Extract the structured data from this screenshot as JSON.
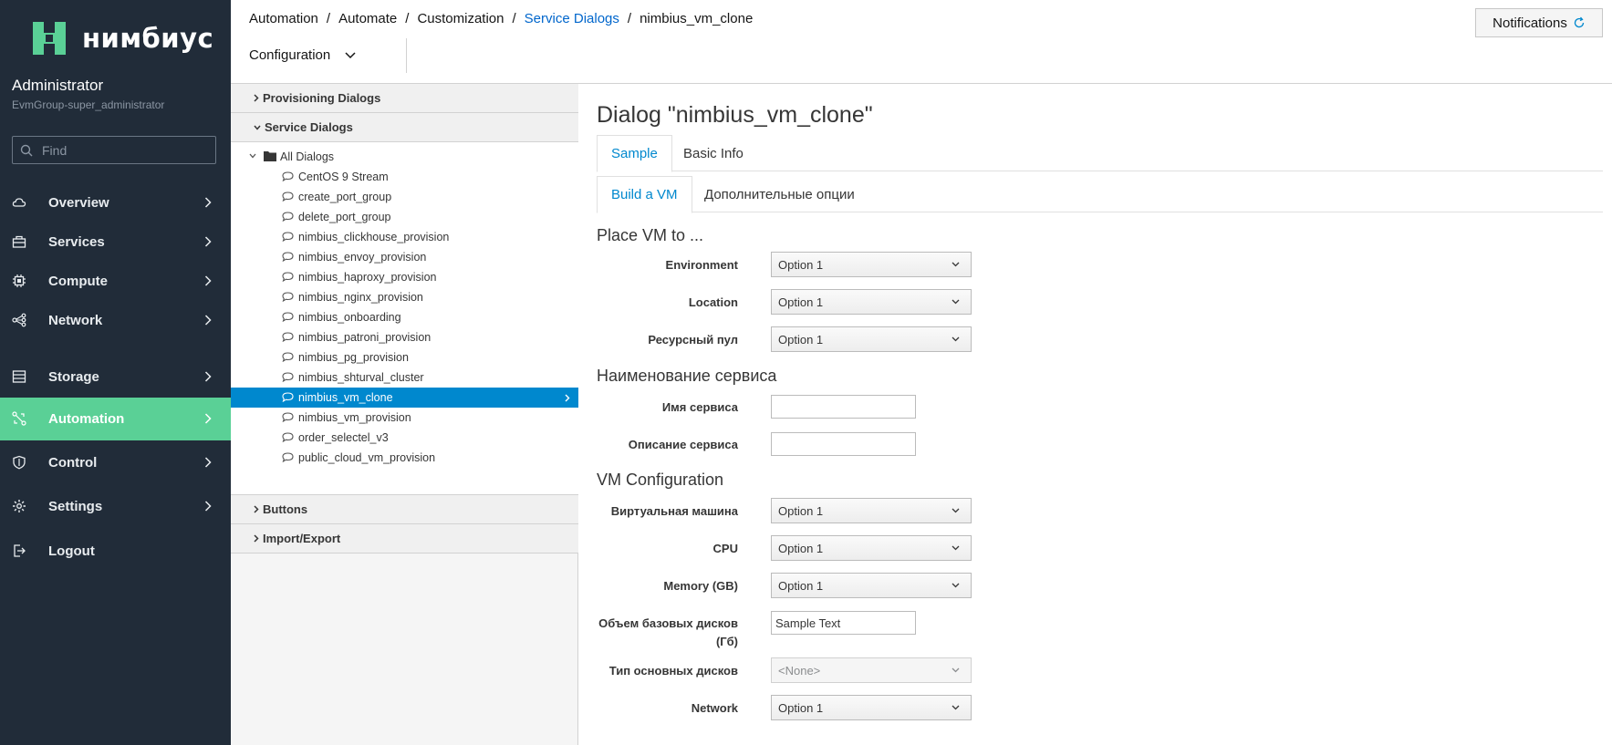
{
  "brand": {
    "name": "нимбиус",
    "accent": "#5ad096"
  },
  "user": {
    "name": "Administrator",
    "group": "EvmGroup-super_administrator"
  },
  "search": {
    "placeholder": "Find"
  },
  "nav": [
    {
      "label": "Overview",
      "icon": "cloud-icon"
    },
    {
      "label": "Services",
      "icon": "services-icon"
    },
    {
      "label": "Compute",
      "icon": "cpu-icon"
    },
    {
      "label": "Network",
      "icon": "network-icon"
    },
    {
      "label": "Storage",
      "icon": "storage-icon"
    },
    {
      "label": "Automation",
      "icon": "automation-icon",
      "active": true
    },
    {
      "label": "Control",
      "icon": "shield-icon"
    },
    {
      "label": "Settings",
      "icon": "gear-icon"
    },
    {
      "label": "Logout",
      "icon": "logout-icon"
    }
  ],
  "breadcrumb": [
    "Automation",
    "Automate",
    "Customization",
    "Service Dialogs",
    "nimbius_vm_clone"
  ],
  "toolbar": {
    "configuration": "Configuration",
    "notifications": "Notifications"
  },
  "accordion": {
    "provisioning": "Provisioning Dialogs",
    "service": "Service Dialogs",
    "buttons": "Buttons",
    "import_export": "Import/Export"
  },
  "tree": {
    "root": "All Dialogs",
    "items": [
      "CentOS 9 Stream",
      "create_port_group",
      "delete_port_group",
      "nimbius_clickhouse_provision",
      "nimbius_envoy_provision",
      "nimbius_haproxy_provision",
      "nimbius_nginx_provision",
      "nimbius_onboarding",
      "nimbius_patroni_provision",
      "nimbius_pg_provision",
      "nimbius_shturval_cluster",
      "nimbius_vm_clone",
      "nimbius_vm_provision",
      "order_selectel_v3",
      "public_cloud_vm_provision"
    ],
    "selected": "nimbius_vm_clone"
  },
  "dialog": {
    "title": "Dialog \"nimbius_vm_clone\"",
    "tabs": [
      "Sample",
      "Basic Info"
    ],
    "subtabs": [
      "Build a VM",
      "Дополнительные опции"
    ],
    "sections": {
      "place": "Place VM to ...",
      "naming": "Наименование сервиса",
      "vmconf": "VM Configuration"
    },
    "fields": {
      "environment": {
        "label": "Environment",
        "value": "Option 1"
      },
      "location": {
        "label": "Location",
        "value": "Option 1"
      },
      "resource_pool": {
        "label": "Ресурсный пул",
        "value": "Option 1"
      },
      "service_name": {
        "label": "Имя сервиса",
        "value": ""
      },
      "service_desc": {
        "label": "Описание сервиса",
        "value": ""
      },
      "vm": {
        "label": "Виртуальная машина",
        "value": "Option 1"
      },
      "cpu": {
        "label": "CPU",
        "value": "Option 1"
      },
      "memory": {
        "label": "Memory (GB)",
        "value": "Option 1"
      },
      "base_disk_line1": {
        "label": "Объем базовых дисков"
      },
      "base_disk_line2": {
        "label": "(Гб)"
      },
      "base_disk": {
        "value": "Sample Text"
      },
      "disk_type": {
        "label": "Тип основных дисков",
        "value": "<None>"
      },
      "network": {
        "label": "Network",
        "value": "Option 1"
      }
    }
  }
}
